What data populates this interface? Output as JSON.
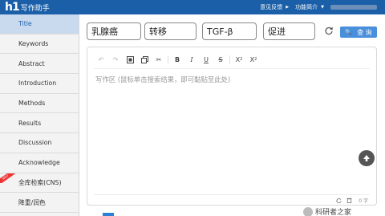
{
  "header": {
    "logo_mark": "h1",
    "logo_text": "写作助手",
    "links": [
      {
        "label": "意见反馈"
      },
      {
        "label": "功能简介"
      }
    ]
  },
  "sidebar": {
    "items": [
      {
        "label": "Title",
        "active": true
      },
      {
        "label": "Keywords"
      },
      {
        "label": "Abstract"
      },
      {
        "label": "Introduction"
      },
      {
        "label": "Methods"
      },
      {
        "label": "Results"
      },
      {
        "label": "Discussion"
      },
      {
        "label": "Acknowledge"
      },
      {
        "label": "全库检索(CNS)",
        "badge": "HOT"
      },
      {
        "label": "降重/润色"
      }
    ]
  },
  "keywords": [
    "乳腺癌",
    "转移",
    "TGF-β",
    "促进"
  ],
  "search": {
    "label": "查 询"
  },
  "editor": {
    "toolbar": {
      "undo": "↶",
      "redo": "↷",
      "bold": "B",
      "italic": "I",
      "underline": "U",
      "strike": "S",
      "subscript_base": "X",
      "subscript_mark": "2",
      "superscript_base": "X",
      "superscript_mark": "2"
    },
    "placeholder": "写作区 (鼠标单击搜索结果，即可黏贴至此处)",
    "char_count": "0 字"
  },
  "watermark": {
    "text": "科研者之家"
  }
}
